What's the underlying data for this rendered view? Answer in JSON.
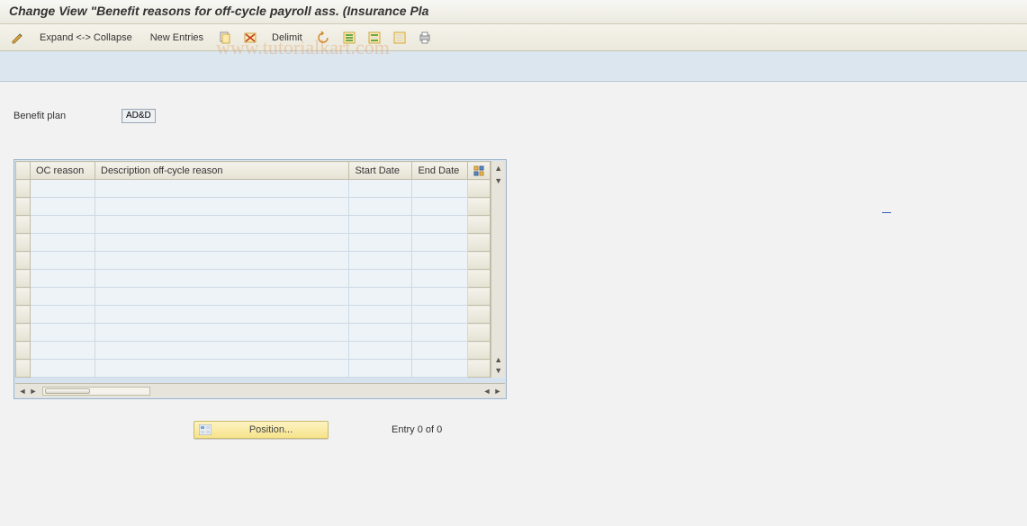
{
  "title": "Change View \"Benefit reasons for off-cycle payroll ass. (Insurance Pla",
  "toolbar": {
    "expand_collapse": "Expand <-> Collapse",
    "new_entries": "New Entries",
    "delimit": "Delimit",
    "icons": {
      "pencil": "edit-icon",
      "copy": "copy-icon",
      "delete": "delete-icon",
      "undo": "undo-icon",
      "select_all": "select-all-icon",
      "select_block": "select-block-icon",
      "deselect": "deselect-icon",
      "print": "print-icon"
    }
  },
  "fields": {
    "benefit_plan_label": "Benefit plan",
    "benefit_plan_value": "AD&D"
  },
  "table": {
    "columns": [
      "OC reason",
      "Description off-cycle reason",
      "Start Date",
      "End Date"
    ],
    "rows": [
      {
        "oc_reason": "",
        "description": "",
        "start_date": "",
        "end_date": ""
      },
      {
        "oc_reason": "",
        "description": "",
        "start_date": "",
        "end_date": ""
      },
      {
        "oc_reason": "",
        "description": "",
        "start_date": "",
        "end_date": ""
      },
      {
        "oc_reason": "",
        "description": "",
        "start_date": "",
        "end_date": ""
      },
      {
        "oc_reason": "",
        "description": "",
        "start_date": "",
        "end_date": ""
      },
      {
        "oc_reason": "",
        "description": "",
        "start_date": "",
        "end_date": ""
      },
      {
        "oc_reason": "",
        "description": "",
        "start_date": "",
        "end_date": ""
      },
      {
        "oc_reason": "",
        "description": "",
        "start_date": "",
        "end_date": ""
      },
      {
        "oc_reason": "",
        "description": "",
        "start_date": "",
        "end_date": ""
      },
      {
        "oc_reason": "",
        "description": "",
        "start_date": "",
        "end_date": ""
      },
      {
        "oc_reason": "",
        "description": "",
        "start_date": "",
        "end_date": ""
      }
    ]
  },
  "footer": {
    "position_label": "Position...",
    "entry_label": "Entry 0 of 0"
  },
  "watermark": "www.tutorialkart.com"
}
